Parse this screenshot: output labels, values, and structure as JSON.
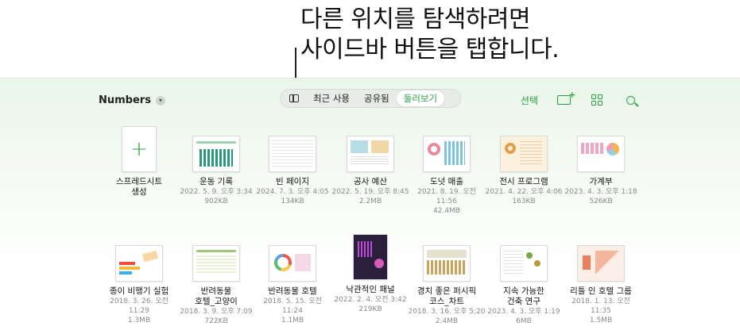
{
  "callout": {
    "line1": "다른 위치를 탐색하려면",
    "line2": "사이드바 버튼을 탭합니다."
  },
  "header": {
    "app_title": "Numbers"
  },
  "tabs": [
    {
      "label": "최근 사용"
    },
    {
      "label": "공유됨"
    },
    {
      "label": "둘러보기",
      "active": true
    }
  ],
  "toolbar": {
    "select_label": "선택"
  },
  "colors": {
    "accent": "#2da044"
  },
  "files": [
    {
      "name": "스프레드시트\n생성",
      "date": "",
      "size": "",
      "kind": "new"
    },
    {
      "name": "운동 기록",
      "date": "2022. 5. 9. 오후 3:34",
      "size": "902KB"
    },
    {
      "name": "빈 페이지",
      "date": "2024. 7. 3. 오후 4:05",
      "size": "134KB"
    },
    {
      "name": "공사 예산",
      "date": "2022. 5. 19. 오후 8:45",
      "size": "2.2MB"
    },
    {
      "name": "도넛 매출",
      "date": "2021. 8. 19. 오전 11:56",
      "size": "42.4MB"
    },
    {
      "name": "전시 프로그램",
      "date": "2021. 4. 22. 오후 4:06",
      "size": "163KB"
    },
    {
      "name": "가계부",
      "date": "2023. 4. 3. 오후 1:18",
      "size": "526KB"
    },
    {
      "name": "종이 비행기 실험",
      "date": "2018. 3. 26. 오전 11:29",
      "size": "1.3MB"
    },
    {
      "name": "반려동물\n호텔_고양이",
      "date": "2018. 3. 9. 오후 7:09",
      "size": "722KB"
    },
    {
      "name": "반려동물 호텔",
      "date": "2018. 5. 15. 오전 11:24",
      "size": "1.1MB"
    },
    {
      "name": "낙관적인 패널",
      "date": "2022. 2. 4. 오전 3:42",
      "size": "219KB"
    },
    {
      "name": "경치 좋은 퍼시픽\n코스_차트",
      "date": "2018. 3. 16. 오후 5:20",
      "size": "2.4MB"
    },
    {
      "name": "지속 가능한\n건축 연구",
      "date": "2023. 4. 3. 오후 1:19",
      "size": "6MB"
    },
    {
      "name": "리틀 인 호텔 그룹",
      "date": "2018. 1. 13. 오전 11:35",
      "size": "1.5MB"
    }
  ]
}
